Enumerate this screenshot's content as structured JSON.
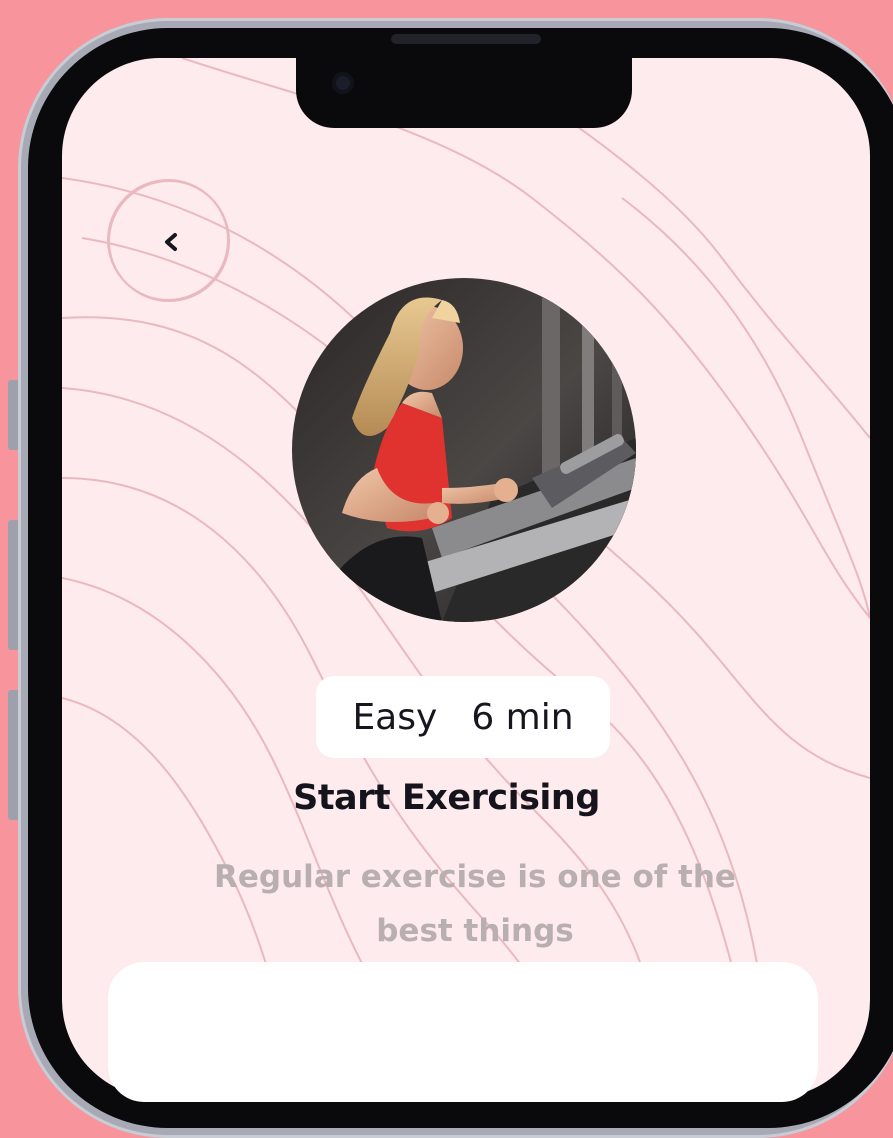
{
  "workout": {
    "difficulty": "Easy",
    "duration": "6 min",
    "title": "Start Exercising",
    "description": "Regular exercise is one of the best things"
  },
  "icons": {
    "back": "chevron-left-icon"
  },
  "colors": {
    "background": "#f7949c",
    "screen": "#fdebed",
    "text_primary": "#15141c",
    "text_secondary": "#b9aeb0",
    "contour_lines": "#eab9bf"
  }
}
